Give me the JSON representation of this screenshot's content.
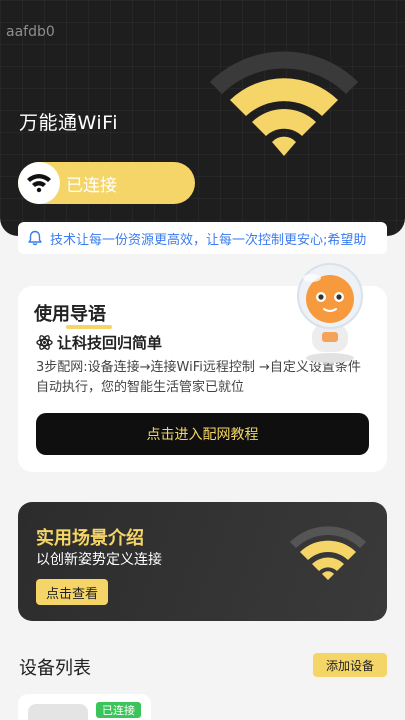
{
  "status_bar": {
    "id_text": "aafdb0"
  },
  "header": {
    "title": "万能通WiFi",
    "connection_label": "已连接"
  },
  "notice": {
    "text": "技术让每一份资源更高效，让每一次控制更安心;希望助"
  },
  "guide": {
    "title": "使用导语",
    "subtitle": "让科技回归简单",
    "description": "3步配网:设备连接→连接WiFi远程控制 →自定义设置条件自动执行，您的智能生活管家已就位",
    "button_label": "点击进入配网教程"
  },
  "scene": {
    "title": "实用场景介绍",
    "subtitle": "以创新姿势定义连接",
    "button_label": "点击查看"
  },
  "devices": {
    "title": "设备列表",
    "add_button_label": "添加设备",
    "items": [
      {
        "status": "已连接"
      }
    ]
  },
  "colors": {
    "accent_yellow": "#f5d567",
    "header_dark": "#1e1e1e",
    "notice_blue": "#3a7bf0",
    "connected_green": "#3bc45a"
  },
  "icons": [
    "wifi-icon",
    "bell-icon",
    "atom-icon",
    "robot-mascot"
  ]
}
